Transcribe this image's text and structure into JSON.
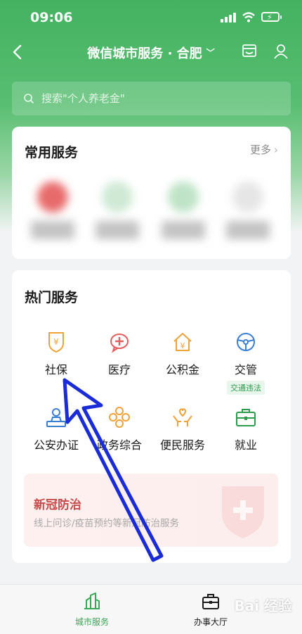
{
  "status_bar": {
    "time": "09:06"
  },
  "nav": {
    "title": "微信城市服务 · 合肥"
  },
  "search": {
    "placeholder": "搜索\"个人养老金\""
  },
  "common_services": {
    "title": "常用服务",
    "more_label": "更多"
  },
  "hot_services": {
    "title": "热门服务",
    "items": [
      {
        "label": "社保",
        "icon": "shebao-icon"
      },
      {
        "label": "医疗",
        "icon": "medical-icon"
      },
      {
        "label": "公积金",
        "icon": "housing-fund-icon"
      },
      {
        "label": "交管",
        "icon": "traffic-icon",
        "tag": "交通违法"
      },
      {
        "label": "公安办证",
        "icon": "police-certificate-icon"
      },
      {
        "label": "政务综合",
        "icon": "government-icon"
      },
      {
        "label": "便民服务",
        "icon": "convenience-icon"
      },
      {
        "label": "就业",
        "icon": "employment-icon"
      }
    ]
  },
  "covid_banner": {
    "title": "新冠防治",
    "subtitle": "线上问诊/疫苗预约等新冠防治服务"
  },
  "tabbar": {
    "items": [
      {
        "label": "城市服务",
        "active": true
      },
      {
        "label": "办事大厅",
        "active": false
      }
    ]
  },
  "watermark": "Bai 经验",
  "colors": {
    "brand_green": "#43b260",
    "orange": "#f0a23a",
    "red": "#e45c5c",
    "blue": "#3a7fd5",
    "arrow": "#1a2bd8"
  }
}
